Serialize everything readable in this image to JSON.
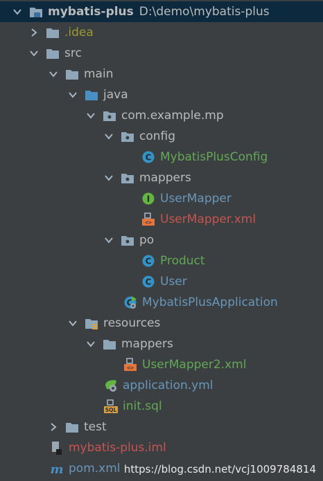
{
  "project": {
    "name": "mybatis-plus",
    "path": "D:\\demo\\mybatis-plus"
  },
  "nodes": {
    "idea": ".idea",
    "src": "src",
    "main": "main",
    "java": "java",
    "package": "com.example.mp",
    "config": "config",
    "mybatis_plus_config": "MybatisPlusConfig",
    "mappers": "mappers",
    "user_mapper": "UserMapper",
    "user_mapper_xml": "UserMapper.xml",
    "po": "po",
    "product": "Product",
    "user": "User",
    "application_class": "MybatisPlusApplication",
    "resources": "resources",
    "res_mappers": "mappers",
    "user_mapper2_xml": "UserMapper2.xml",
    "application_yml": "application.yml",
    "init_sql": "init.sql",
    "test": "test",
    "iml": "mybatis-plus.iml",
    "pom": "pom.xml"
  },
  "watermark": "https://blog.csdn.net/vcj1009784814",
  "colors": {
    "background": "#3c3f41",
    "selection": "#0d293e",
    "text": "#bbbbbb",
    "excluded": "#9c9a35",
    "added": "#62a856",
    "modified": "#6897bb",
    "unversioned": "#c75450"
  },
  "icons": {
    "folder": "folder-icon",
    "source-folder": "source-folder-icon",
    "package": "package-icon",
    "class": "class-icon",
    "interface": "interface-icon",
    "xml": "xml-icon",
    "spring-boot": "spring-boot-application-icon",
    "resources": "resources-folder-icon",
    "yaml": "yaml-icon",
    "sql": "sql-icon",
    "iml": "iml-icon",
    "maven": "maven-icon"
  }
}
